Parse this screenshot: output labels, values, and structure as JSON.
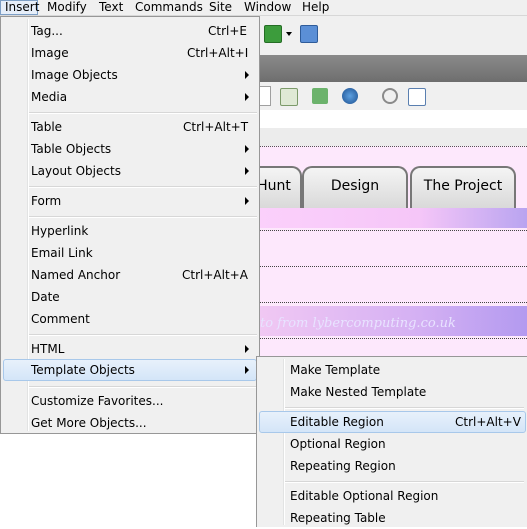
{
  "menubar": {
    "items": [
      "Insert",
      "Modify",
      "Text",
      "Commands",
      "Site",
      "Window",
      "Help"
    ]
  },
  "insert_menu": {
    "items": [
      {
        "label": "Tag...",
        "shortcut": "Ctrl+E"
      },
      {
        "label": "Image",
        "shortcut": "Ctrl+Alt+I"
      },
      {
        "label": "Image Objects",
        "submenu": true
      },
      {
        "label": "Media",
        "submenu": true
      },
      {
        "label": "Table",
        "shortcut": "Ctrl+Alt+T"
      },
      {
        "label": "Table Objects",
        "submenu": true
      },
      {
        "label": "Layout Objects",
        "submenu": true
      },
      {
        "label": "Form",
        "submenu": true
      },
      {
        "label": "Hyperlink"
      },
      {
        "label": "Email Link"
      },
      {
        "label": "Named Anchor",
        "shortcut": "Ctrl+Alt+A"
      },
      {
        "label": "Date"
      },
      {
        "label": "Comment"
      },
      {
        "label": "HTML",
        "submenu": true
      },
      {
        "label": "Template Objects",
        "submenu": true,
        "highlighted": true
      },
      {
        "label": "Customize Favorites..."
      },
      {
        "label": "Get More Objects..."
      }
    ]
  },
  "template_submenu": {
    "items": [
      {
        "label": "Make Template"
      },
      {
        "label": "Make Nested Template"
      },
      {
        "label": "Editable Region",
        "shortcut": "Ctrl+Alt+V",
        "highlighted": true
      },
      {
        "label": "Optional Region"
      },
      {
        "label": "Repeating Region"
      },
      {
        "label": "Editable Optional Region"
      },
      {
        "label": "Repeating Table"
      }
    ]
  },
  "page": {
    "tabs": [
      "Hunt",
      "Design",
      "The Project"
    ],
    "credit": "to from lybercomputing.co.uk"
  },
  "colors": {
    "menu_bg": "#f0f0f0",
    "highlight": "#d4e5f8",
    "canvas_pink": "#fde8fc",
    "band_purple": "#b9a4f0"
  }
}
